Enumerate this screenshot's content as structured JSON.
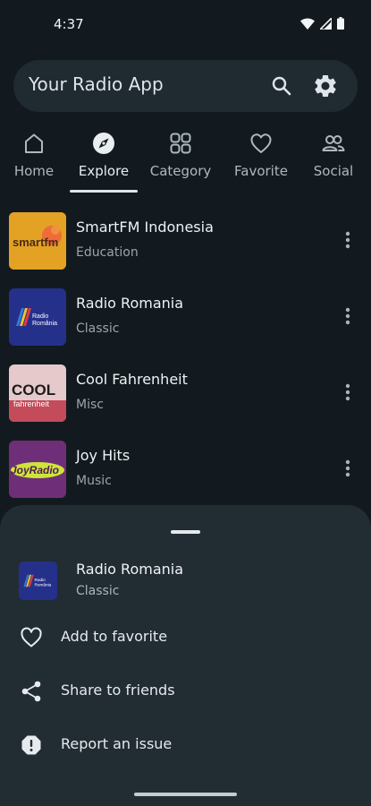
{
  "status_bar": {
    "time": "4:37"
  },
  "search_bar": {
    "title": "Your Radio App",
    "search_icon": "search-icon",
    "settings_icon": "gear-icon"
  },
  "tabs": [
    {
      "label": "Home",
      "icon": "home-icon",
      "active": false
    },
    {
      "label": "Explore",
      "icon": "compass-icon",
      "active": true
    },
    {
      "label": "Category",
      "icon": "grid-icon",
      "active": false
    },
    {
      "label": "Favorite",
      "icon": "heart-icon",
      "active": false
    },
    {
      "label": "Social",
      "icon": "people-icon",
      "active": false
    }
  ],
  "stations": [
    {
      "name": "SmartFM Indonesia",
      "genre": "Education",
      "logo_text": "smartfm"
    },
    {
      "name": "Radio Romania",
      "genre": "Classic",
      "logo_text": "Radio România"
    },
    {
      "name": "Cool Fahrenheit",
      "genre": "Misc",
      "logo_text": "COOL fahrenheit"
    },
    {
      "name": "Joy Hits",
      "genre": "Music",
      "logo_text": "JoyRadio"
    }
  ],
  "sheet": {
    "station_name": "Radio Romania",
    "station_genre": "Classic",
    "actions": [
      {
        "label": "Add to favorite",
        "icon": "heart-outline-icon"
      },
      {
        "label": "Share to friends",
        "icon": "share-icon"
      },
      {
        "label": "Report an issue",
        "icon": "report-icon"
      }
    ]
  },
  "colors": {
    "background": "#121a1f",
    "surface": "#202a31",
    "sheet": "#222c33",
    "text": "#e7ecef",
    "muted": "#9aa5ac"
  }
}
